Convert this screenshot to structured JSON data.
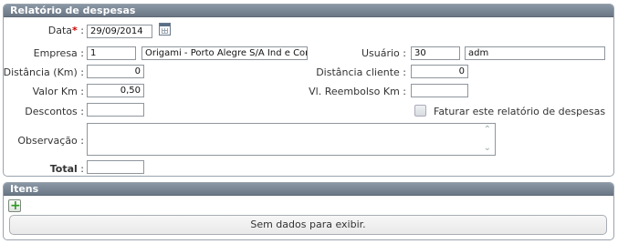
{
  "expense_panel": {
    "title": "Relatório de despesas",
    "data_label": "Data",
    "data_value": "29/09/2014",
    "empresa_label": "Empresa :",
    "empresa_code": "1",
    "empresa_name": "Origami - Porto Alegre S/A Ind e Com",
    "usuario_label": "Usuário :",
    "usuario_code": "30",
    "usuario_name": "adm",
    "distancia_label": "Distância (Km) :",
    "distancia_value": "0",
    "distancia_cliente_label": "Distância cliente :",
    "distancia_cliente_value": "0",
    "valor_km_label": "Valor Km :",
    "valor_km_value": "0,50",
    "reembolso_label": "Vl. Reembolso Km :",
    "reembolso_value": "",
    "descontos_label": "Descontos :",
    "descontos_value": "",
    "faturar_label": "Faturar este relatório de despesas",
    "faturar_checked": false,
    "observacao_label": "Observação :",
    "observacao_value": "",
    "total_label": "Total",
    "total_value": ""
  },
  "items_panel": {
    "title": "Itens",
    "empty_message": "Sem dados para exibir."
  },
  "colors": {
    "header": "#7b8896",
    "required": "#d00000",
    "add_icon": "#2e9a22"
  },
  "icons": [
    "calendar-icon",
    "add-icon",
    "scroll-up-icon",
    "scroll-down-icon"
  ]
}
